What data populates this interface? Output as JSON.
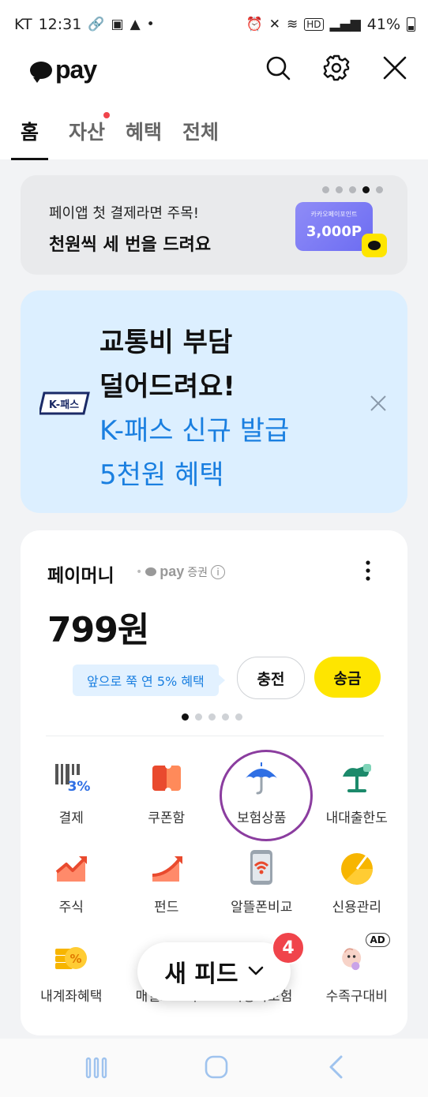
{
  "status_bar": {
    "carrier": "KT",
    "time": "12:31",
    "battery": "41%"
  },
  "header": {
    "logo_text": "pay",
    "tabs": [
      {
        "label": "홈",
        "active": true
      },
      {
        "label": "자산",
        "has_dot": true
      },
      {
        "label": "혜택"
      },
      {
        "label": "전체"
      }
    ]
  },
  "promo": {
    "subtitle": "페이앱 첫 결제라면 주목!",
    "title": "천원씩 세 번을 드려요",
    "point_card_small": "카카오페이포인트",
    "point_card_amount": "3,000P",
    "dots_total": 5,
    "dots_active_index": 3
  },
  "kpass_banner": {
    "logo_text": "K-패스",
    "line1": "교통비 부담",
    "line2": "덜어드려요!",
    "line3": "K-패스 신규 발급",
    "line4": "5천원 혜택"
  },
  "pay_money": {
    "label": "페이머니",
    "meta_pay": "pay",
    "meta_text": "증권",
    "info_icon": "i",
    "amount": "799원",
    "tip": "앞으로 쭉 연 5% 혜택",
    "charge_label": "충전",
    "send_label": "송금"
  },
  "grid_items": [
    {
      "label": "결제",
      "icon": "barcode-3percent-icon"
    },
    {
      "label": "쿠폰함",
      "icon": "coupon-icon"
    },
    {
      "label": "보험상품",
      "icon": "umbrella-icon"
    },
    {
      "label": "내대출한도",
      "icon": "scale-icon"
    },
    {
      "label": "주식",
      "icon": "stock-chart-icon"
    },
    {
      "label": "펀드",
      "icon": "fund-chart-icon"
    },
    {
      "label": "알뜰폰비교",
      "icon": "phone-signal-icon"
    },
    {
      "label": "신용관리",
      "icon": "credit-gauge-icon"
    },
    {
      "label": "내계좌혜택",
      "icon": "coins-icon"
    },
    {
      "label": "매일모으기",
      "icon": "piggy-icon"
    },
    {
      "label": "자동차보험",
      "icon": "car-icon"
    },
    {
      "label": "수족구대비",
      "icon": "character-ad-icon"
    }
  ],
  "ad_label": "AD",
  "feed": {
    "label": "새 피드",
    "badge": "4"
  },
  "colors": {
    "accent_yellow": "#fee500",
    "link_blue": "#1a7fe0",
    "badge_red": "#f0444b",
    "highlight_purple": "#8b3d9f"
  }
}
